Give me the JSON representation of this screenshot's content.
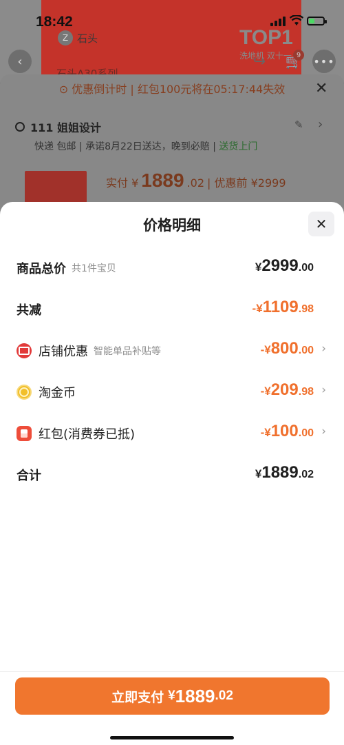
{
  "status_bar": {
    "time": "18:42"
  },
  "background": {
    "brand_name": "石头",
    "brand_logo": "Z",
    "top_badge": "TOP1",
    "top_badge_sub": "洗地机 双十一",
    "series_text": "石头A30系列",
    "cart_count": "9",
    "countdown": "⊙ 优惠倒计时 | 红包100元将在05:17:44失效",
    "address": "111 姐姐设计",
    "shipping_prefix": "快递 包邮 | 承诺8月22日送达，晚到必赔 | ",
    "shipping_highlight": "送货上门",
    "price_label": "实付 ¥",
    "price_int": "1889",
    "price_dec": ".02",
    "price_before": "| 优惠前 ¥2999"
  },
  "sheet": {
    "title": "价格明细",
    "rows": [
      {
        "label": "商品总价",
        "sub": "共1件宝贝",
        "cur": "¥",
        "int": "2999",
        "dec": ".00",
        "style": "dark"
      },
      {
        "label": "共减",
        "sub": "",
        "cur": "-¥",
        "int": "1109",
        "dec": ".98",
        "style": "orange"
      },
      {
        "label": "店铺优惠",
        "sub": "智能单品补贴等",
        "cur": "-¥",
        "int": "800",
        "dec": ".00",
        "style": "orange",
        "icon": "shop-icon"
      },
      {
        "label": "淘金币",
        "sub": "",
        "cur": "-¥",
        "int": "209",
        "dec": ".98",
        "style": "orange",
        "icon": "coin-icon"
      },
      {
        "label": "红包(消费券已抵)",
        "sub": "",
        "cur": "-¥",
        "int": "100",
        "dec": ".00",
        "style": "orange",
        "icon": "red-packet-icon"
      },
      {
        "label": "合计",
        "sub": "",
        "cur": "¥",
        "int": "1889",
        "dec": ".02",
        "style": "dark"
      }
    ],
    "pay_button": {
      "label": "立即支付",
      "cur": "¥",
      "int": "1889",
      "dec": ".02"
    }
  },
  "colors": {
    "accent": "#f0762e",
    "discount": "#f0702d"
  }
}
